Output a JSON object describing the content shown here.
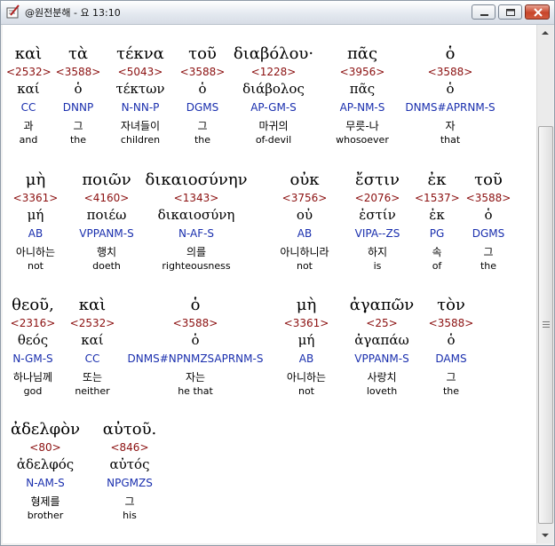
{
  "window": {
    "title": "@원전분해 - 요 13:10",
    "icons": {
      "app": "document-tool-icon",
      "minimize": "minimize-icon",
      "maximize": "maximize-icon",
      "close": "close-icon"
    },
    "accent_color": "#c8452a"
  },
  "colors": {
    "strong_number": "#8b1010",
    "parsing": "#1a2fae",
    "text": "#000000"
  },
  "rows": [
    {
      "words": [
        {
          "greek": "καὶ",
          "strongs": "<2532>",
          "lemma": "καί",
          "parse": "CC",
          "korean": "과",
          "english": "and"
        },
        {
          "greek": "τὰ",
          "strongs": "<3588>",
          "lemma": "ὁ",
          "parse": "DNNP",
          "korean": "그",
          "english": "the"
        },
        {
          "greek": "τέκνα",
          "strongs": "<5043>",
          "lemma": "τέκτων",
          "parse": "N-NN-P",
          "korean": "자녀들이",
          "english": "children"
        },
        {
          "greek": "τοῦ",
          "strongs": "<3588>",
          "lemma": "ὁ",
          "parse": "DGMS",
          "korean": "그",
          "english": "the"
        },
        {
          "greek": "διαβόλου·",
          "strongs": "<1228>",
          "lemma": "διάβολος",
          "parse": "AP-GM-S",
          "korean": "마귀의",
          "english": "of-devil"
        },
        {
          "greek": "πᾶς",
          "strongs": "<3956>",
          "lemma": "πᾶς",
          "parse": "AP-NM-S",
          "korean": "무릇-나",
          "english": "whosoever"
        },
        {
          "greek": "ὁ",
          "strongs": "<3588>",
          "lemma": "ὁ",
          "parse": "DNMS#APRNM-S",
          "korean": "자",
          "english": "that"
        }
      ]
    },
    {
      "words": [
        {
          "greek": "μὴ",
          "strongs": "<3361>",
          "lemma": "μή",
          "parse": "AB",
          "korean": "아니하는",
          "english": "not"
        },
        {
          "greek": "ποιῶν",
          "strongs": "<4160>",
          "lemma": "ποιέω",
          "parse": "VPPANM-S",
          "korean": "행치",
          "english": "doeth"
        },
        {
          "greek": "δικαιοσύνην",
          "strongs": "<1343>",
          "lemma": "δικαιοσύνη",
          "parse": "N-AF-S",
          "korean": "의를",
          "english": "righteousness"
        },
        {
          "greek": "οὐκ",
          "strongs": "<3756>",
          "lemma": "οὐ",
          "parse": "AB",
          "korean": "아니하니라",
          "english": "not"
        },
        {
          "greek": "ἔστιν",
          "strongs": "<2076>",
          "lemma": "ἐστίν",
          "parse": "VIPA--ZS",
          "korean": "하지",
          "english": "is"
        },
        {
          "greek": "ἐκ",
          "strongs": "<1537>",
          "lemma": "ἐκ",
          "parse": "PG",
          "korean": "속",
          "english": "of"
        },
        {
          "greek": "τοῦ",
          "strongs": "<3588>",
          "lemma": "ὁ",
          "parse": "DGMS",
          "korean": "그",
          "english": "the"
        }
      ]
    },
    {
      "words": [
        {
          "greek": "θεοῦ,",
          "strongs": "<2316>",
          "lemma": "θεός",
          "parse": "N-GM-S",
          "korean": "하나님께",
          "english": "god"
        },
        {
          "greek": "καὶ",
          "strongs": "<2532>",
          "lemma": "καί",
          "parse": "CC",
          "korean": "또는",
          "english": "neither"
        },
        {
          "greek": "ὁ",
          "strongs": "<3588>",
          "lemma": "ὁ",
          "parse": "DNMS#NPNMZSAPRNM-S",
          "korean": "자는",
          "english": "he that"
        },
        {
          "greek": "μὴ",
          "strongs": "<3361>",
          "lemma": "μή",
          "parse": "AB",
          "korean": "아니하는",
          "english": "not"
        },
        {
          "greek": "ἀγαπῶν",
          "strongs": "<25>",
          "lemma": "ἀγαπάω",
          "parse": "VPPANM-S",
          "korean": "사랑치",
          "english": "loveth"
        },
        {
          "greek": "τὸν",
          "strongs": "<3588>",
          "lemma": "ὁ",
          "parse": "DAMS",
          "korean": "그",
          "english": "the"
        }
      ]
    },
    {
      "words": [
        {
          "greek": "ἀδελφὸν",
          "strongs": "<80>",
          "lemma": "ἀδελφός",
          "parse": "N-AM-S",
          "korean": "형제를",
          "english": "brother"
        },
        {
          "greek": "αὐτοῦ.",
          "strongs": "<846>",
          "lemma": "αὐτός",
          "parse": "NPGMZS",
          "korean": "그",
          "english": "his"
        }
      ]
    }
  ],
  "scrollbar": {
    "up_icon": "scroll-up-arrow-icon",
    "down_icon": "scroll-down-arrow-icon"
  }
}
